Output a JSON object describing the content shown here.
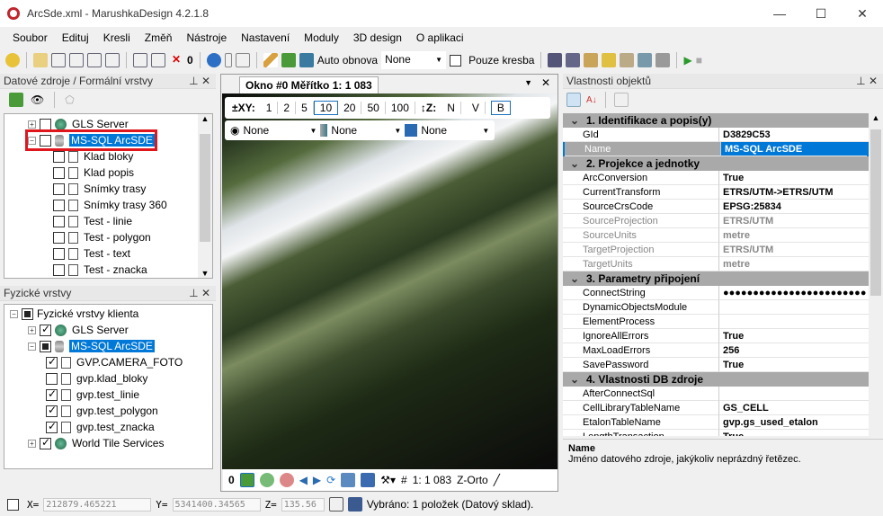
{
  "window": {
    "title": "ArcSde.xml - MarushkaDesign 4.2.1.8",
    "minimize": "—",
    "maximize": "☐",
    "close": "✕"
  },
  "menu": [
    "Soubor",
    "Edituj",
    "Kresli",
    "Změň",
    "Nástroje",
    "Nastavení",
    "Moduly",
    "3D design",
    "O aplikaci"
  ],
  "toolbar": {
    "count": "0",
    "auto_label": "Auto obnova",
    "auto_value": "None",
    "draw_only": "Pouze kresba"
  },
  "left_top": {
    "title": "Datové zdroje / Formální vrstvy",
    "items": [
      {
        "label": "GLS Server",
        "type": "globe"
      },
      {
        "label": "MS-SQL ArcSDE",
        "type": "db"
      },
      {
        "label": "Klad bloky"
      },
      {
        "label": "Klad popis"
      },
      {
        "label": "Snímky trasy"
      },
      {
        "label": "Snímky trasy 360"
      },
      {
        "label": "Test - linie"
      },
      {
        "label": "Test - polygon"
      },
      {
        "label": "Test - text"
      },
      {
        "label": "Test - znacka"
      }
    ]
  },
  "left_bottom": {
    "title": "Fyzické vrstvy",
    "items": [
      {
        "label": "Fyzické vrstvy klienta"
      },
      {
        "label": "GLS Server"
      },
      {
        "label": "MS-SQL ArcSDE"
      },
      {
        "label": "GVP.CAMERA_FOTO"
      },
      {
        "label": "gvp.klad_bloky"
      },
      {
        "label": "gvp.test_linie"
      },
      {
        "label": "gvp.test_polygon"
      },
      {
        "label": "gvp.test_znacka"
      },
      {
        "label": "World Tile Services"
      }
    ]
  },
  "map": {
    "tab": "Okno #0 Měřítko 1:  1 083",
    "xy_label": "±XY:",
    "zoom_steps": [
      "1",
      "2",
      "5",
      "10",
      "20",
      "50",
      "100"
    ],
    "z_label": "↕Z:",
    "z_options": [
      "N",
      "V",
      "B"
    ],
    "layer_selects": [
      "None",
      "None",
      "None"
    ],
    "bottom_count": "0",
    "scale": "1:  1 083",
    "ortho": "Z-Orto"
  },
  "properties": {
    "title": "Vlastnosti objektů",
    "categories": [
      {
        "name": "1. Identifikace a popis(y)",
        "rows": [
          {
            "n": "GId",
            "v": "D3829C53"
          },
          {
            "n": "Name",
            "v": "MS-SQL ArcSDE",
            "sel": true
          }
        ]
      },
      {
        "name": "2. Projekce a jednotky",
        "rows": [
          {
            "n": "ArcConversion",
            "v": "True"
          },
          {
            "n": "CurrentTransform",
            "v": "ETRS/UTM->ETRS/UTM"
          },
          {
            "n": "SourceCrsCode",
            "v": "EPSG:25834"
          },
          {
            "n": "SourceProjection",
            "v": "ETRS/UTM",
            "ro": true
          },
          {
            "n": "SourceUnits",
            "v": "metre",
            "ro": true
          },
          {
            "n": "TargetProjection",
            "v": "ETRS/UTM",
            "ro": true
          },
          {
            "n": "TargetUnits",
            "v": "metre",
            "ro": true
          }
        ]
      },
      {
        "name": "3. Parametry připojení",
        "rows": [
          {
            "n": "ConnectString",
            "v": "●●●●●●●●●●●●●●●●●●●●●●●●"
          },
          {
            "n": "DynamicObjectsModule",
            "v": ""
          },
          {
            "n": "ElementProcess",
            "v": ""
          },
          {
            "n": "IgnoreAllErrors",
            "v": "True"
          },
          {
            "n": "MaxLoadErrors",
            "v": "256"
          },
          {
            "n": "SavePassword",
            "v": "True"
          }
        ]
      },
      {
        "name": "4. Vlastnosti DB zdroje",
        "rows": [
          {
            "n": "AfterConnectSql",
            "v": ""
          },
          {
            "n": "CellLibraryTableName",
            "v": "GS_CELL"
          },
          {
            "n": "EtalonTableName",
            "v": "gvp.gs_used_etalon"
          },
          {
            "n": "LengthTransaction",
            "v": "True"
          }
        ]
      }
    ],
    "desc_title": "Name",
    "desc_text": "Jméno datového zdroje, jakýkoliv neprázdný řetězec."
  },
  "status": {
    "x_label": "X=",
    "x": "212879.465221",
    "y_label": "Y=",
    "y": "5341400.34565",
    "z_label": "Z=",
    "z": "135.56",
    "selection": "Vybráno: 1  položek (Datový sklad)."
  }
}
